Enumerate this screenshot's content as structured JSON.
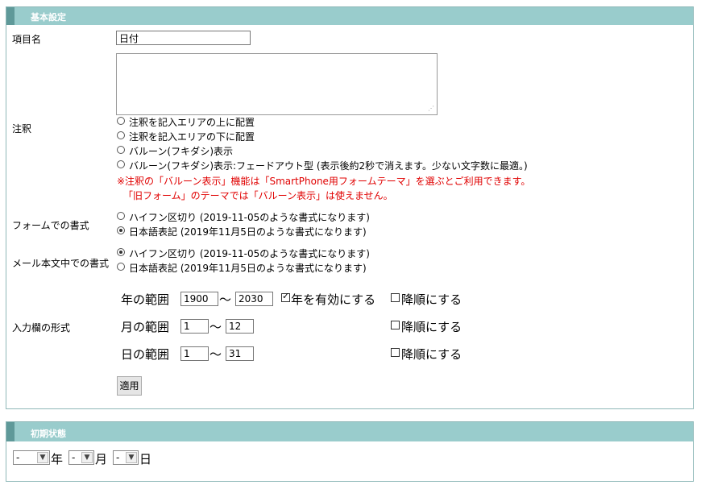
{
  "basic": {
    "title": "基本設定",
    "item_name": {
      "label": "項目名",
      "value": "日付"
    },
    "annotation": {
      "label": "注釈",
      "options": [
        {
          "label": "注釈を記入エリアの上に配置",
          "checked": false
        },
        {
          "label": "注釈を記入エリアの下に配置",
          "checked": false
        },
        {
          "label": "バルーン(フキダシ)表示",
          "checked": false
        },
        {
          "label": "バルーン(フキダシ)表示:フェードアウト型 (表示後約2秒で消えます。少ない文字数に最適。)",
          "checked": false
        }
      ],
      "notes": [
        "※注釈の「バルーン表示」機能は「SmartPhone用フォームテーマ」を選ぶとご利用できます。",
        "「旧フォーム」のテーマでは「バルーン表示」は使えません。"
      ]
    },
    "form_format": {
      "label": "フォームでの書式",
      "options": [
        {
          "label": "ハイフン区切り (2019-11-05のような書式になります)",
          "checked": false
        },
        {
          "label": "日本語表記 (2019年11月5日のような書式になります)",
          "checked": true
        }
      ]
    },
    "mail_format": {
      "label": "メール本文中での書式",
      "options": [
        {
          "label": "ハイフン区切り (2019-11-05のような書式になります)",
          "checked": true
        },
        {
          "label": "日本語表記 (2019年11月5日のような書式になります)",
          "checked": false
        }
      ]
    },
    "input_format": {
      "label": "入力欄の形式",
      "tilde": "～",
      "year": {
        "label": "年の範囲",
        "from": "1900",
        "to": "2030",
        "enable_label": "年を有効にする",
        "enable_checked": true,
        "desc_label": "降順にする",
        "desc_checked": false
      },
      "month": {
        "label": "月の範囲",
        "from": "1",
        "to": "12",
        "desc_label": "降順にする",
        "desc_checked": false
      },
      "day": {
        "label": "日の範囲",
        "from": "1",
        "to": "31",
        "desc_label": "降順にする",
        "desc_checked": false
      }
    },
    "apply_label": "適用"
  },
  "initial": {
    "title": "初期状態",
    "year_value": "-",
    "year_suffix": "年",
    "month_value": "-",
    "month_suffix": "月",
    "day_value": "-",
    "day_suffix": "日"
  }
}
